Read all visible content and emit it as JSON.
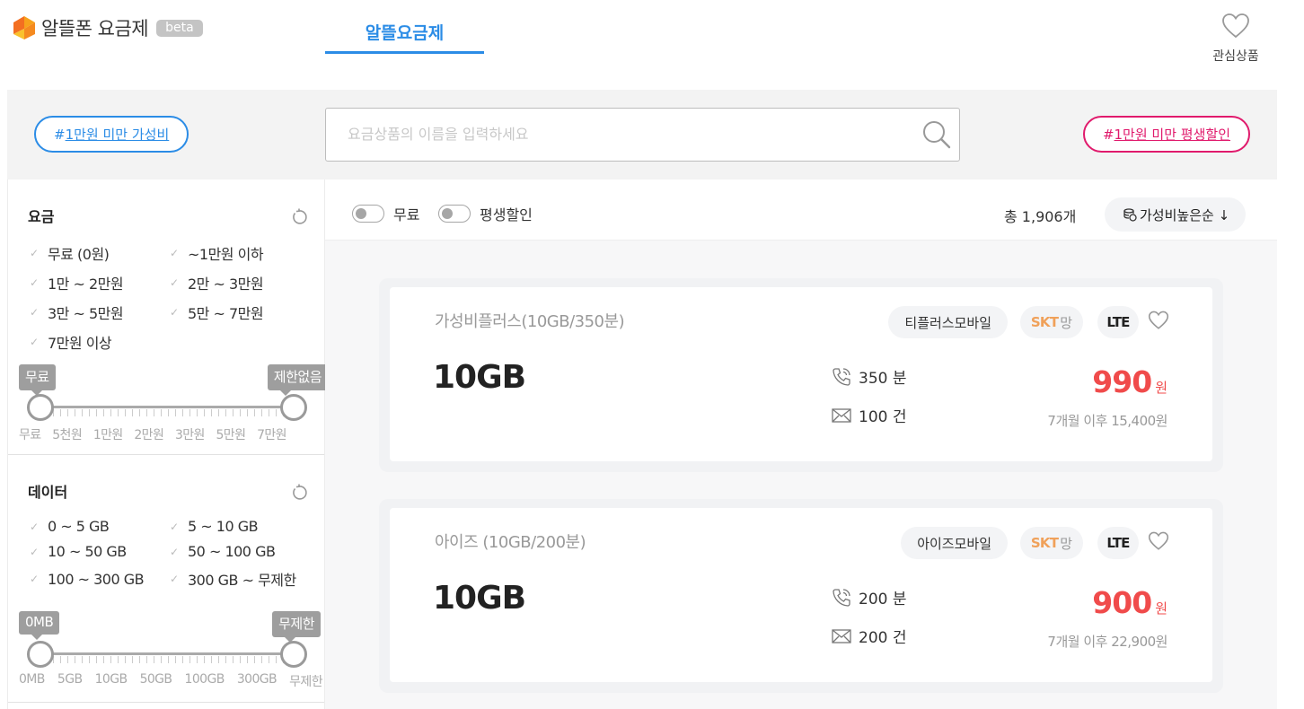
{
  "header": {
    "app_name": "알뜰폰 요금제",
    "badge": "beta",
    "tab": "알뜰요금제",
    "favorites_label": "관심상품"
  },
  "search": {
    "left_chip_hash": "#",
    "left_chip": "1만원 미만 가성비",
    "right_chip_hash": "#",
    "right_chip": "1만원 미만 평생할인",
    "placeholder": "요금상품의 이름을 입력하세요"
  },
  "filters": {
    "price": {
      "title": "요금",
      "options": [
        "무료 (0원)",
        "~1만원 이하",
        "1만 ~ 2만원",
        "2만 ~ 3만원",
        "3만 ~ 5만원",
        "5만 ~ 7만원",
        "7만원 이상"
      ],
      "min_label": "무료",
      "max_label": "제한없음",
      "ticks": [
        "무료",
        "5천원",
        "1만원",
        "2만원",
        "3만원",
        "5만원",
        "7만원"
      ]
    },
    "data": {
      "title": "데이터",
      "options": [
        "0 ~ 5 GB",
        "5 ~ 10 GB",
        "10 ~ 50 GB",
        "50 ~ 100 GB",
        "100 ~ 300 GB",
        "300 GB ~ 무제한"
      ],
      "min_label": "0MB",
      "max_label": "무제한",
      "ticks": [
        "0MB",
        "5GB",
        "10GB",
        "50GB",
        "100GB",
        "300GB",
        "무제한"
      ]
    }
  },
  "toolbar": {
    "toggle_free": "무료",
    "toggle_lifetime": "평생할인",
    "total": "총 1,906개",
    "sort": "가성비높은순 ↓"
  },
  "plans": [
    {
      "name": "가성비플러스(10GB/350분)",
      "carrier": "티플러스모바일",
      "network": "SKT",
      "network_suffix": "망",
      "tech": "LTE",
      "data": "10GB",
      "voice": "350 분",
      "sms": "100 건",
      "price": "990",
      "price_unit": "원",
      "after": "7개월 이후 15,400원"
    },
    {
      "name": "아이즈 (10GB/200분)",
      "carrier": "아이즈모바일",
      "network": "SKT",
      "network_suffix": "망",
      "tech": "LTE",
      "data": "10GB",
      "voice": "200 분",
      "sms": "200 건",
      "price": "900",
      "price_unit": "원",
      "after": "7개월 이후 22,900원"
    }
  ],
  "colors": {
    "accent_blue": "#2b8ce6",
    "accent_pink": "#e01a6c",
    "price_red": "#f04b4b",
    "skt_orange": "#f0a15a"
  }
}
